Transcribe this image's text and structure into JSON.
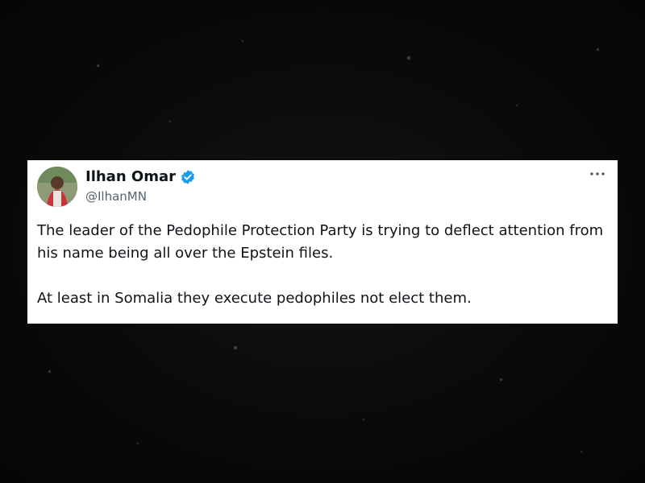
{
  "tweet": {
    "author": {
      "display_name": "Ilhan Omar",
      "handle": "@IlhanMN",
      "verified": true,
      "avatar_icon": "profile-photo"
    },
    "paragraphs": [
      "The leader of the Pedophile Protection Party is trying to deflect attention from his name being all over the Epstein files.",
      "At least in Somalia they execute pedophiles not elect them."
    ],
    "more_icon": "ellipsis-icon"
  },
  "colors": {
    "background": "#0a0a0a",
    "card": "#ffffff",
    "text": "#0f1419",
    "handle": "#536471",
    "verified_badge": "#1d9bf0"
  }
}
